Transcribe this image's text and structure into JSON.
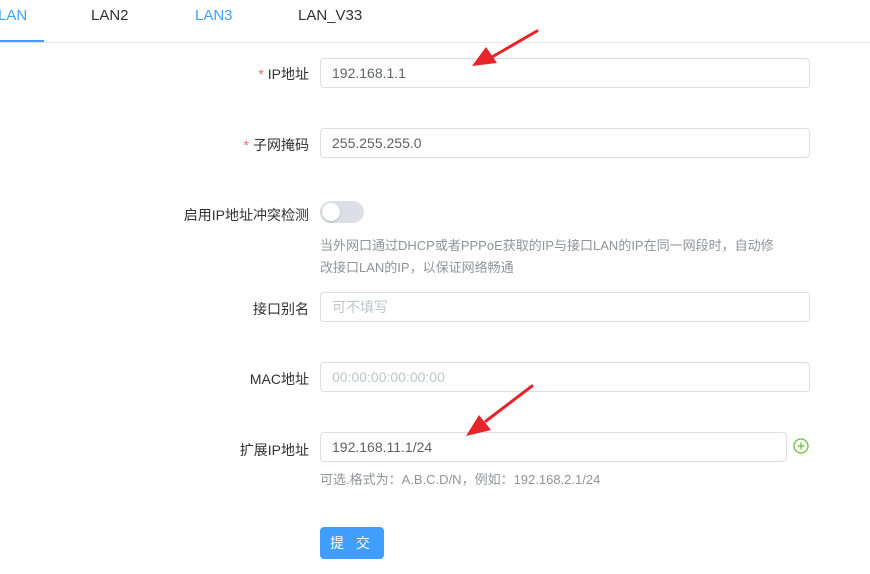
{
  "tabs": [
    {
      "label": "LAN"
    },
    {
      "label": "LAN2"
    },
    {
      "label": "LAN3"
    },
    {
      "label": "LAN_V33"
    }
  ],
  "form": {
    "ip": {
      "required_mark": "*",
      "label": "IP地址",
      "value": "192.168.1.1"
    },
    "mask": {
      "required_mark": "*",
      "label": "子网掩码",
      "value": "255.255.255.0"
    },
    "conflict": {
      "label": "启用IP地址冲突检测",
      "enabled": false,
      "help_line1": "当外网口通过DHCP或者PPPoE获取的IP与接口LAN的IP在同一网段时，自动修",
      "help_line2": "改接口LAN的IP，以保证网络畅通"
    },
    "alias": {
      "label": "接口别名",
      "placeholder": "可不填写"
    },
    "mac": {
      "label": "MAC地址",
      "placeholder": "00:00:00:00:00:00"
    },
    "ext_ip": {
      "label": "扩展IP地址",
      "value": "192.168.11.1/24",
      "help": "可选.格式为：A.B.C.D/N，例如：192.168.2.1/24"
    },
    "submit_label": "提 交"
  },
  "colors": {
    "accent": "#409eff",
    "required": "#f56c6c",
    "add": "#67c23a",
    "arrow": "#e8242b"
  }
}
